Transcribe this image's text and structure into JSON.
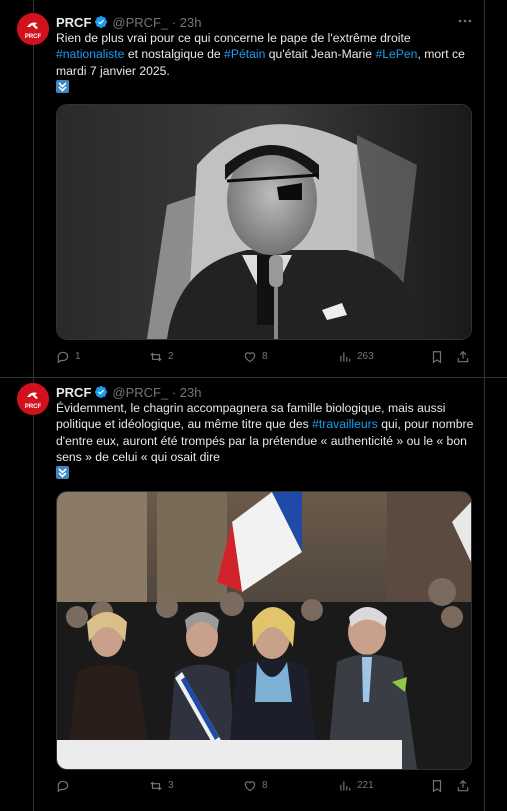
{
  "tweets": [
    {
      "author_name": "PRCF",
      "avatar_label": "PRCF",
      "handle_time": "@PRCF_ · 23h",
      "text_parts": [
        {
          "t": "Rien de plus vrai pour ce qui concerne le pape de l'extrême droite "
        },
        {
          "t": "#nationaliste",
          "tag": true
        },
        {
          "t": " et nostalgique de "
        },
        {
          "t": "#Pétain",
          "tag": true
        },
        {
          "t": " qu'était Jean-Marie "
        },
        {
          "t": "#LePen",
          "tag": true
        },
        {
          "t": ", mort ce mardi 7 janvier 2025."
        }
      ],
      "emoji": "arrow-double-down-icon",
      "media_description_icon": "portrait-photo",
      "stats": {
        "replies": "1",
        "reposts": "2",
        "likes": "8",
        "views": "263"
      }
    },
    {
      "author_name": "PRCF",
      "avatar_label": "PRCF",
      "handle_time": "@PRCF_ · 23h",
      "text_parts": [
        {
          "t": "Évidemment, le chagrin accompagnera sa famille biologique, mais aussi politique et idéologique, au même titre que des "
        },
        {
          "t": "#travailleurs",
          "tag": true
        },
        {
          "t": " qui, pour nombre d'entre eux, auront été trompés par la prétendue « authenticité » ou le « bon sens » de celui « qui osait dire"
        }
      ],
      "emoji": "arrow-double-down-icon",
      "media_description_icon": "crowd-photo",
      "stats": {
        "replies": "",
        "reposts": "3",
        "likes": "8",
        "views": "221"
      }
    }
  ],
  "colors": {
    "accent": "#1d9bf0",
    "brand": "#d1121c",
    "muted": "#71767b",
    "text": "#e7e9ea",
    "background": "#000000"
  }
}
